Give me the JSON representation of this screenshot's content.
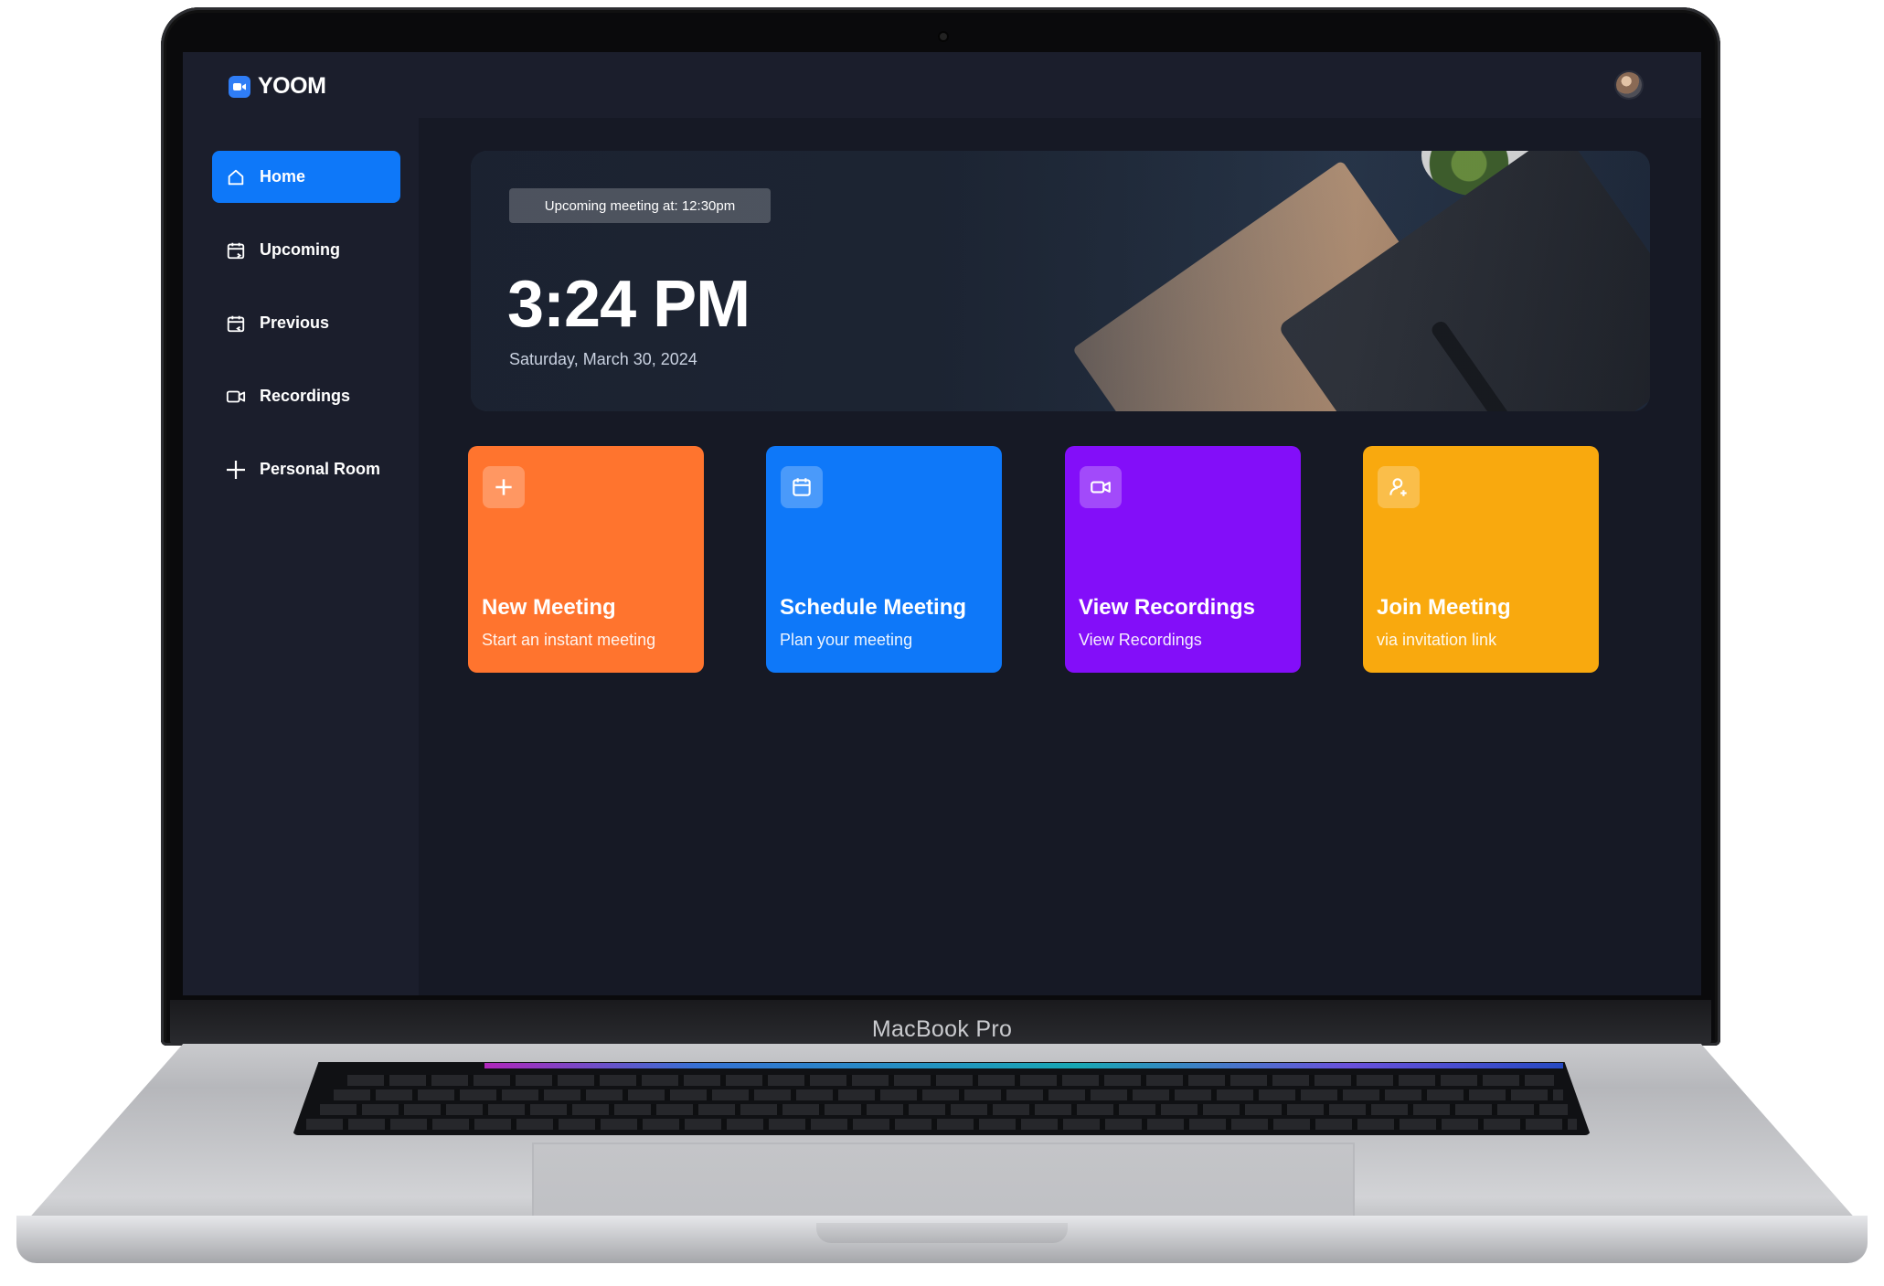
{
  "device": {
    "brand_label": "MacBook Pro"
  },
  "app": {
    "name": "YOOM",
    "accent": "#0e78f9"
  },
  "sidebar": {
    "items": [
      {
        "label": "Home",
        "icon": "home-icon",
        "active": true
      },
      {
        "label": "Upcoming",
        "icon": "calendar-forward-icon",
        "active": false
      },
      {
        "label": "Previous",
        "icon": "calendar-back-icon",
        "active": false
      },
      {
        "label": "Recordings",
        "icon": "video-icon",
        "active": false
      },
      {
        "label": "Personal Room",
        "icon": "plus-icon",
        "active": false
      }
    ]
  },
  "hero": {
    "upcoming": "Upcoming meeting at: 12:30pm",
    "time": "3:24 PM",
    "date": "Saturday, March 30, 2024"
  },
  "cards": [
    {
      "title": "New Meeting",
      "subtitle": "Start an instant meeting",
      "icon": "plus-icon",
      "color": "#ff742e"
    },
    {
      "title": "Schedule Meeting",
      "subtitle": "Plan your meeting",
      "icon": "calendar-icon",
      "color": "#0e78f9"
    },
    {
      "title": "View Recordings",
      "subtitle": "View Recordings",
      "icon": "video-icon",
      "color": "#830ef9"
    },
    {
      "title": "Join Meeting",
      "subtitle": "via invitation link",
      "icon": "user-add-icon",
      "color": "#f9a90e"
    }
  ]
}
